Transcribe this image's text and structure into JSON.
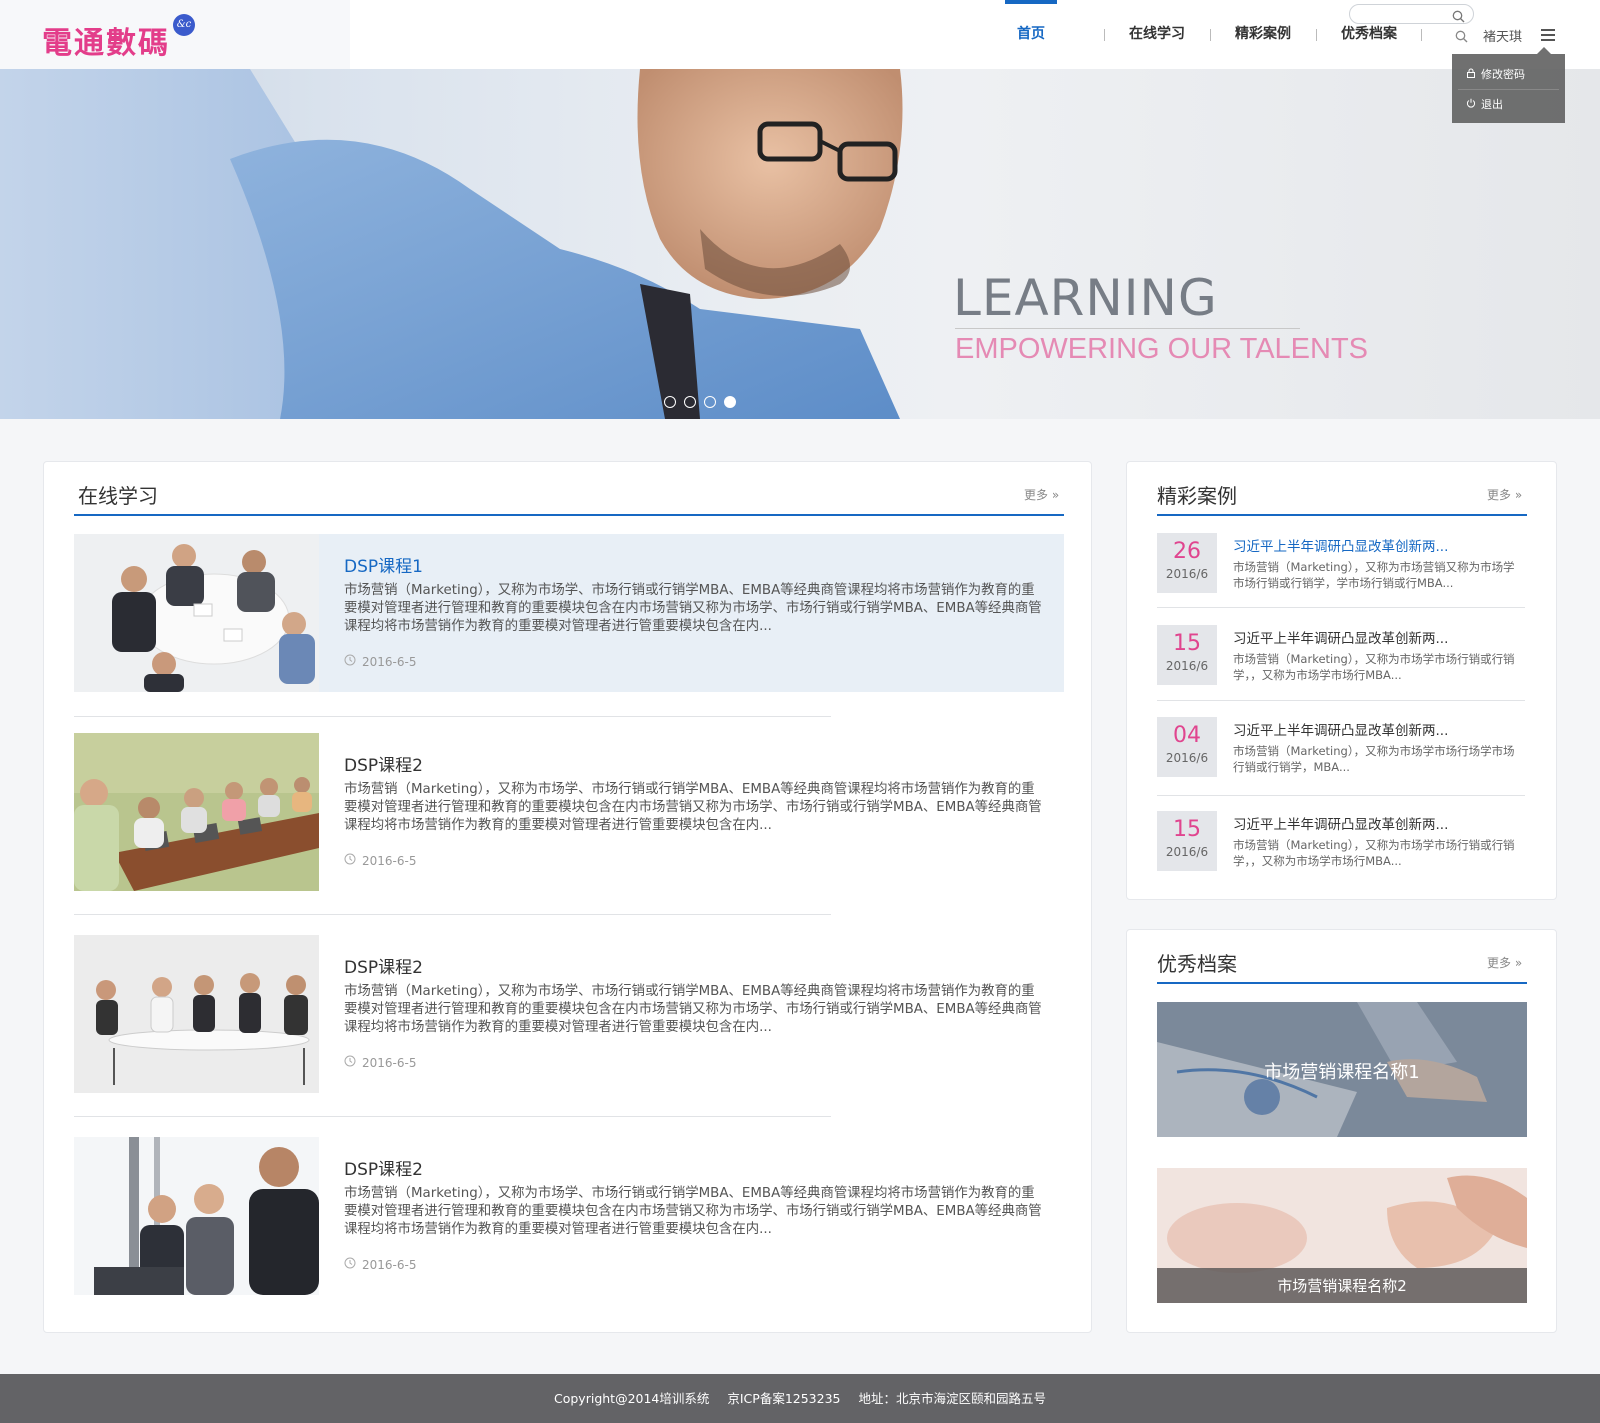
{
  "logo": {
    "text": "電通數碼",
    "badge": "&c"
  },
  "nav": {
    "items": [
      "首页",
      "在线学习",
      "精彩案例",
      "优秀档案"
    ],
    "active": 0
  },
  "search": {
    "value": ""
  },
  "user": {
    "name": "褚天琪"
  },
  "user_menu": {
    "change_password": "修改密码",
    "logout": "退出"
  },
  "banner": {
    "title": "LEARNING",
    "subtitle": "EMPOWERING OUR TALENTS",
    "slide_count": 4,
    "active_slide": 4
  },
  "online_learning": {
    "title": "在线学习",
    "more": "更多 »",
    "courses": [
      {
        "title": "DSP课程1",
        "desc": "市场营销（Marketing），又称为市场学、市场行销或行销学MBA、EMBA等经典商管课程均将市场营销作为教育的重要模对管理者进行管理和教育的重要模块包含在内市场营销又称为市场学、市场行销或行销学MBA、EMBA等经典商管课程均将市场营销作为教育的重要模对管理者进行管重要模块包含在内...",
        "date": "2016-6-5"
      },
      {
        "title": "DSP课程2",
        "desc": "市场营销（Marketing），又称为市场学、市场行销或行销学MBA、EMBA等经典商管课程均将市场营销作为教育的重要模对管理者进行管理和教育的重要模块包含在内市场营销又称为市场学、市场行销或行销学MBA、EMBA等经典商管课程均将市场营销作为教育的重要模对管理者进行管重要模块包含在内...",
        "date": "2016-6-5"
      },
      {
        "title": "DSP课程2",
        "desc": "市场营销（Marketing），又称为市场学、市场行销或行销学MBA、EMBA等经典商管课程均将市场营销作为教育的重要模对管理者进行管理和教育的重要模块包含在内市场营销又称为市场学、市场行销或行销学MBA、EMBA等经典商管课程均将市场营销作为教育的重要模对管理者进行管重要模块包含在内...",
        "date": "2016-6-5"
      },
      {
        "title": "DSP课程2",
        "desc": "市场营销（Marketing），又称为市场学、市场行销或行销学MBA、EMBA等经典商管课程均将市场营销作为教育的重要模对管理者进行管理和教育的重要模块包含在内市场营销又称为市场学、市场行销或行销学MBA、EMBA等经典商管课程均将市场营销作为教育的重要模对管理者进行管重要模块包含在内...",
        "date": "2016-6-5"
      }
    ]
  },
  "cases": {
    "title": "精彩案例",
    "more": "更多 »",
    "items": [
      {
        "day": "26",
        "month": "2016/6",
        "title": "习近平上半年调研凸显改革创新两...",
        "desc": "市场营销（Marketing），又称为市场营销又称为市场学市场行销或行销学，学市场行销或行MBA..."
      },
      {
        "day": "15",
        "month": "2016/6",
        "title": "习近平上半年调研凸显改革创新两...",
        "desc": "市场营销（Marketing），又称为市场学市场行销或行销学，，又称为市场学市场行MBA..."
      },
      {
        "day": "04",
        "month": "2016/6",
        "title": "习近平上半年调研凸显改革创新两...",
        "desc": "市场营销（Marketing），又称为市场学市场行场学市场行销或行销学，MBA..."
      },
      {
        "day": "15",
        "month": "2016/6",
        "title": "习近平上半年调研凸显改革创新两...",
        "desc": "市场营销（Marketing），又称为市场学市场行销或行销学，，又称为市场学市场行MBA..."
      }
    ]
  },
  "archives": {
    "title": "优秀档案",
    "more": "更多 »",
    "items": [
      {
        "label": "市场营销课程名称1"
      },
      {
        "label": "市场营销课程名称2"
      }
    ]
  },
  "footer": {
    "copyright": "Copyright@2014培训系统",
    "icp": "京ICP备案1253235",
    "address": "地址：北京市海淀区颐和园路五号"
  },
  "colors": {
    "accent": "#1668c3",
    "brand": "#e33d8a",
    "footer": "#636366"
  }
}
